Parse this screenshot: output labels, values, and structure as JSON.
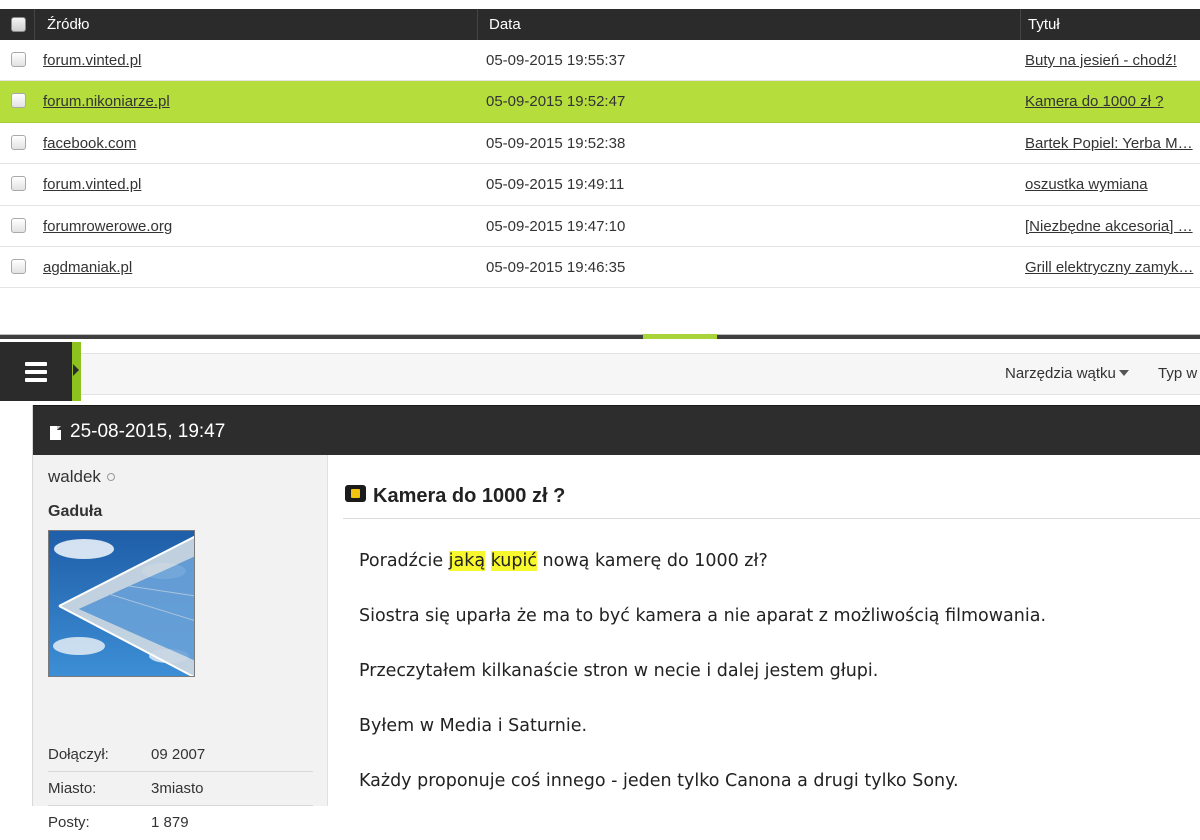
{
  "results": {
    "headers": {
      "source": "Źródło",
      "date": "Data",
      "title": "Tytuł"
    },
    "rows": [
      {
        "source": "forum.vinted.pl",
        "date": "05-09-2015 19:55:37",
        "title": "Buty na jesień - chodź!",
        "highlighted": false
      },
      {
        "source": "forum.nikoniarze.pl",
        "date": "05-09-2015 19:52:47",
        "title": "Kamera do 1000 zł ?",
        "highlighted": true
      },
      {
        "source": "facebook.com",
        "date": "05-09-2015 19:52:38",
        "title": "Bartek Popiel: Yerba M…",
        "highlighted": false
      },
      {
        "source": "forum.vinted.pl",
        "date": "05-09-2015 19:49:11",
        "title": "oszustka wymiana",
        "highlighted": false
      },
      {
        "source": "forumrowerowe.org",
        "date": "05-09-2015 19:47:10",
        "title": "[Niezbędne akcesoria] …",
        "highlighted": false
      },
      {
        "source": "agdmaniak.pl",
        "date": "05-09-2015 19:46:35",
        "title": "Grill elektryczny zamyk…",
        "highlighted": false
      }
    ]
  },
  "toolbar": {
    "menu_icon": "hamburger-menu-icon",
    "thread_tools_label": "Narzędzia wątku",
    "type_label": "Typ w"
  },
  "post": {
    "date": "25-08-2015, 19:47",
    "user": {
      "name": "waldek",
      "rank": "Gaduła",
      "stats": [
        {
          "label": "Dołączył:",
          "value": "09 2007"
        },
        {
          "label": "Miasto:",
          "value": "3miasto"
        },
        {
          "label": "Posty:",
          "value": "1 879"
        }
      ]
    },
    "title": "Kamera do 1000 zł ?",
    "body": {
      "p1_before": "Poradźcie ",
      "p1_mark1": "jaką",
      "p1_mid": " ",
      "p1_mark2": "kupić",
      "p1_after": " nową kamerę do 1000 zł?",
      "p2": "Siostra się uparła że ma to być kamera a nie aparat z możliwością filmowania.",
      "p3": "Przeczytałem kilkanaście stron w necie i dalej jestem głupi.",
      "p4": "Byłem w Media i Saturnie.",
      "p5": "Każdy proponuje coś innego - jeden tylko Canona a drugi tylko Sony."
    }
  },
  "colors": {
    "highlight_row": "#b5de3c",
    "header_bg": "#2b2b2b",
    "accent_green": "#8ec21e",
    "search_mark": "#f7f82e"
  }
}
